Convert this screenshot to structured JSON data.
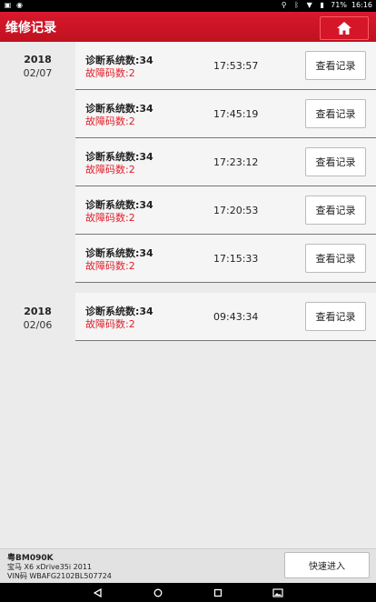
{
  "statusbar": {
    "battery": "71%",
    "time": "16:16"
  },
  "header": {
    "title": "维修记录"
  },
  "groups": [
    {
      "year": "2018",
      "md": "02/07",
      "records": [
        {
          "sys": "诊断系统数:34",
          "fault": "故障码数:2",
          "time": "17:53:57",
          "button": "查看记录"
        },
        {
          "sys": "诊断系统数:34",
          "fault": "故障码数:2",
          "time": "17:45:19",
          "button": "查看记录"
        },
        {
          "sys": "诊断系统数:34",
          "fault": "故障码数:2",
          "time": "17:23:12",
          "button": "查看记录"
        },
        {
          "sys": "诊断系统数:34",
          "fault": "故障码数:2",
          "time": "17:20:53",
          "button": "查看记录"
        },
        {
          "sys": "诊断系统数:34",
          "fault": "故障码数:2",
          "time": "17:15:33",
          "button": "查看记录"
        }
      ]
    },
    {
      "year": "2018",
      "md": "02/06",
      "records": [
        {
          "sys": "诊断系统数:34",
          "fault": "故障码数:2",
          "time": "09:43:34",
          "button": "查看记录"
        }
      ]
    }
  ],
  "footer": {
    "plate": "粤BM090K",
    "car": "宝马 X6 xDrive35i 2011",
    "vin": "VIN码 WBAFG2102BL507724",
    "quick_button": "快速进入"
  },
  "colors": {
    "brand": "#c8141f",
    "fault": "#e0202b"
  }
}
